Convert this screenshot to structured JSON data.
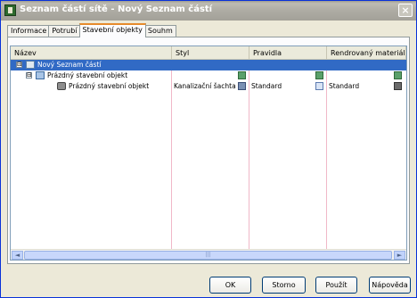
{
  "window": {
    "title": "Seznam částí sítě - Nový Seznam částí",
    "close_glyph": "×"
  },
  "tabs": [
    "Informace",
    "Potrubí",
    "Stavební objekty",
    "Souhm"
  ],
  "active_tab": 2,
  "grid": {
    "columns": [
      "Název",
      "Styl",
      "Pravidla",
      "Rendrovaný materiál"
    ],
    "rows": [
      {
        "name": "Nový Seznam částí",
        "level": 0,
        "expander": "⊟",
        "icon": "parts-list-icon",
        "selected": true,
        "style": "",
        "rules": "",
        "material": ""
      },
      {
        "name": "Prázdný stavební objekt",
        "level": 1,
        "expander": "⊟",
        "icon": "structure-icon",
        "selected": false,
        "style": "",
        "rules": "",
        "material": "",
        "style_icon": "check-icon",
        "rules_icon": "check-icon",
        "material_icon": "check-icon"
      },
      {
        "name": "Prázdný stavební objekt",
        "level": 2,
        "expander": "",
        "icon": "object-icon",
        "selected": false,
        "style": "Kanalizační šachta",
        "rules": "Standard",
        "material": "Standard",
        "style_icon": "shaft-icon",
        "rules_icon": "brush-icon",
        "material_icon": "layers-icon"
      }
    ],
    "scroll_left": "◄",
    "scroll_right": "►",
    "scroll_grip": "|||"
  },
  "buttons": {
    "ok": "OK",
    "cancel": "Storno",
    "apply": "Použít",
    "help": "Nápověda"
  }
}
